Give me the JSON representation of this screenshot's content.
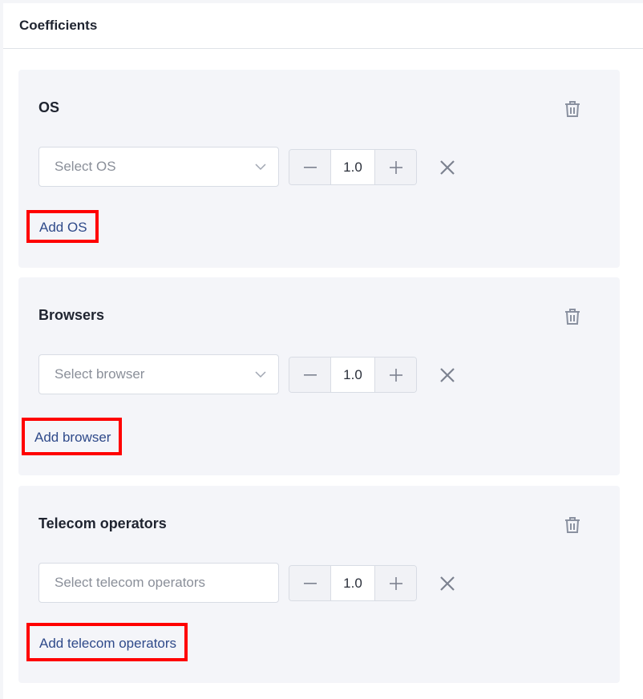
{
  "header": {
    "title": "Coefficients"
  },
  "sections": [
    {
      "title": "OS",
      "placeholder": "Select OS",
      "value": "1.0",
      "add_label": "Add OS",
      "has_chevron": true
    },
    {
      "title": "Browsers",
      "placeholder": "Select browser",
      "value": "1.0",
      "add_label": "Add browser",
      "has_chevron": true
    },
    {
      "title": "Telecom operators",
      "placeholder": "Select telecom operators",
      "value": "1.0",
      "add_label": "Add telecom operators",
      "has_chevron": false
    }
  ],
  "icons": {
    "delete": "trash-icon",
    "remove": "close-icon",
    "decrement": "minus-icon",
    "increment": "plus-icon",
    "dropdown": "chevron-down-icon"
  },
  "colors": {
    "link": "#2f4a8a",
    "highlight": "#ff0000",
    "icon": "#8a91a0",
    "card_bg": "#f4f5f9"
  }
}
